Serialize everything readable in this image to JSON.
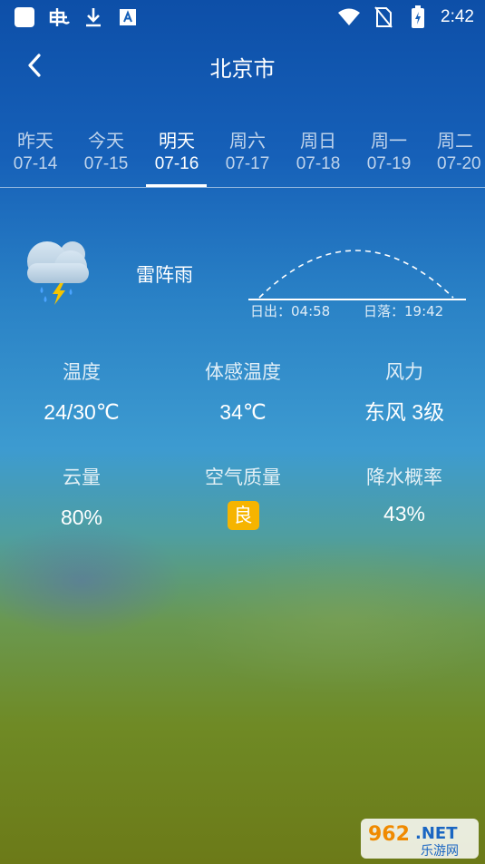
{
  "status_bar": {
    "time": "2:42",
    "left_icons": [
      "square-app-icon",
      "bug-icon",
      "download-icon",
      "translate-icon"
    ],
    "right_icons": [
      "wifi-icon",
      "no-sim-icon",
      "battery-charging-icon"
    ]
  },
  "header": {
    "title": "北京市",
    "back_icon": "chevron-left-icon"
  },
  "tabs": [
    {
      "day": "昨天",
      "date": "07-14",
      "active": false
    },
    {
      "day": "今天",
      "date": "07-15",
      "active": false
    },
    {
      "day": "明天",
      "date": "07-16",
      "active": true
    },
    {
      "day": "周六",
      "date": "07-17",
      "active": false
    },
    {
      "day": "周日",
      "date": "07-18",
      "active": false
    },
    {
      "day": "周一",
      "date": "07-19",
      "active": false
    },
    {
      "day": "周二",
      "date": "07-20",
      "active": false
    }
  ],
  "weather": {
    "icon": "thunderstorm-cloud-icon",
    "condition": "雷阵雨",
    "sunrise": "日出：04:58",
    "sunset": "日落：19:42"
  },
  "stats": {
    "temperature": {
      "label": "温度",
      "value": "24/30℃"
    },
    "feels_like": {
      "label": "体感温度",
      "value": "34℃"
    },
    "wind": {
      "label": "风力",
      "value": "东风 3级"
    },
    "cloud_cover": {
      "label": "云量",
      "value": "80%"
    },
    "air_quality": {
      "label": "空气质量",
      "value": "良",
      "badge_color": "#f6b400"
    },
    "precipitation": {
      "label": "降水概率",
      "value": "43%"
    }
  },
  "watermark": {
    "text_top": "962.NET",
    "text_bottom": "乐游网"
  }
}
